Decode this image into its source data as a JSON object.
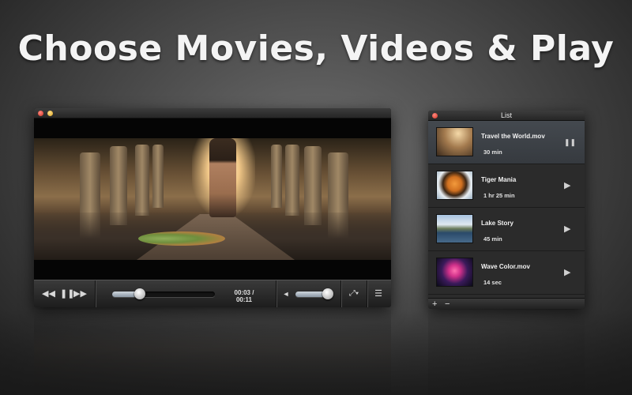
{
  "headline": "Choose Movies, Videos & Play",
  "player": {
    "controls": {
      "rewind_icon": "rewind-icon",
      "pause_icon": "pause-icon",
      "forward_icon": "fast-forward-icon",
      "time": "00:03 / 00:11",
      "progress": 0.27,
      "volume_icon": "speaker-icon",
      "volume": 0.9,
      "fullscreen_icon": "fullscreen-icon",
      "playlist_icon": "list-icon"
    }
  },
  "list": {
    "title": "List",
    "items": [
      {
        "title": "Travel the World.mov",
        "duration": "30 min",
        "state": "pause",
        "state_glyph": "❚❚",
        "thumbnail": "legs-walking"
      },
      {
        "title": "Tiger Mania",
        "duration": "1 hr 25 min",
        "state": "play",
        "state_glyph": "▶",
        "thumbnail": "tiger"
      },
      {
        "title": "Lake Story",
        "duration": "45 min",
        "state": "play",
        "state_glyph": "▶",
        "thumbnail": "lake"
      },
      {
        "title": "Wave Color.mov",
        "duration": "14 sec",
        "state": "play",
        "state_glyph": "▶",
        "thumbnail": "pink-smoke"
      }
    ],
    "footer": {
      "add": "+",
      "remove": "−"
    }
  }
}
